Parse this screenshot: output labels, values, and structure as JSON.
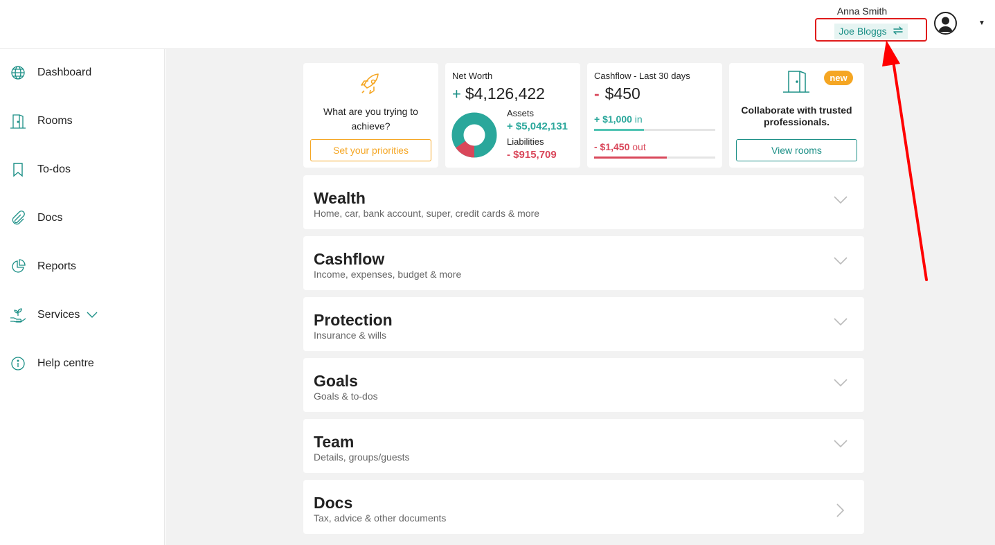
{
  "header": {
    "user_name": "Anna Smith",
    "active_profile": "Joe Bloggs",
    "switch_icon": "swap-arrows-icon",
    "avatar_icon": "user-avatar-icon"
  },
  "sidebar": {
    "items": [
      {
        "label": "Dashboard",
        "icon": "globe-icon"
      },
      {
        "label": "Rooms",
        "icon": "door-icon"
      },
      {
        "label": "To-dos",
        "icon": "bookmark-icon"
      },
      {
        "label": "Docs",
        "icon": "paperclip-icon"
      },
      {
        "label": "Reports",
        "icon": "pie-chart-icon"
      },
      {
        "label": "Services",
        "icon": "plant-hand-icon"
      },
      {
        "label": "Help centre",
        "icon": "info-icon"
      }
    ]
  },
  "cards": {
    "priorities": {
      "text": "What are you trying to achieve?",
      "button": "Set your priorities",
      "icon": "rocket-icon"
    },
    "net_worth": {
      "title": "Net Worth",
      "sign": "+",
      "value": "$4,126,422",
      "assets_label": "Assets",
      "assets_value": "+ $5,042,131",
      "liabilities_label": "Liabilities",
      "liabilities_value": "- $915,709",
      "assets_fraction": 0.846
    },
    "cashflow": {
      "title": "Cashflow - Last 30 days",
      "sign": "-",
      "value": "$450",
      "in_amount": "+ $1,000",
      "in_label": "in",
      "out_amount": "- $1,450",
      "out_label": "out",
      "in_fraction": 0.41,
      "out_fraction": 0.6
    },
    "rooms": {
      "badge": "new",
      "text": "Collaborate with trusted professionals.",
      "button": "View rooms",
      "icon": "door-icon"
    }
  },
  "sections": [
    {
      "title": "Wealth",
      "subtitle": "Home, car, bank account, super, credit cards & more",
      "chevron": "chevron-down-icon"
    },
    {
      "title": "Cashflow",
      "subtitle": "Income, expenses, budget & more",
      "chevron": "chevron-down-icon"
    },
    {
      "title": "Protection",
      "subtitle": "Insurance & wills",
      "chevron": "chevron-down-icon"
    },
    {
      "title": "Goals",
      "subtitle": "Goals & to-dos",
      "chevron": "chevron-down-icon"
    },
    {
      "title": "Team",
      "subtitle": "Details, groups/guests",
      "chevron": "chevron-down-icon"
    },
    {
      "title": "Docs",
      "subtitle": "Tax, advice & other documents",
      "chevron": "chevron-right-icon"
    }
  ],
  "colors": {
    "teal": "#1b8f86",
    "teal_light": "#2aa79b",
    "orange": "#f5a623",
    "red": "#d9475a",
    "annotation_red": "#e01b1b"
  }
}
